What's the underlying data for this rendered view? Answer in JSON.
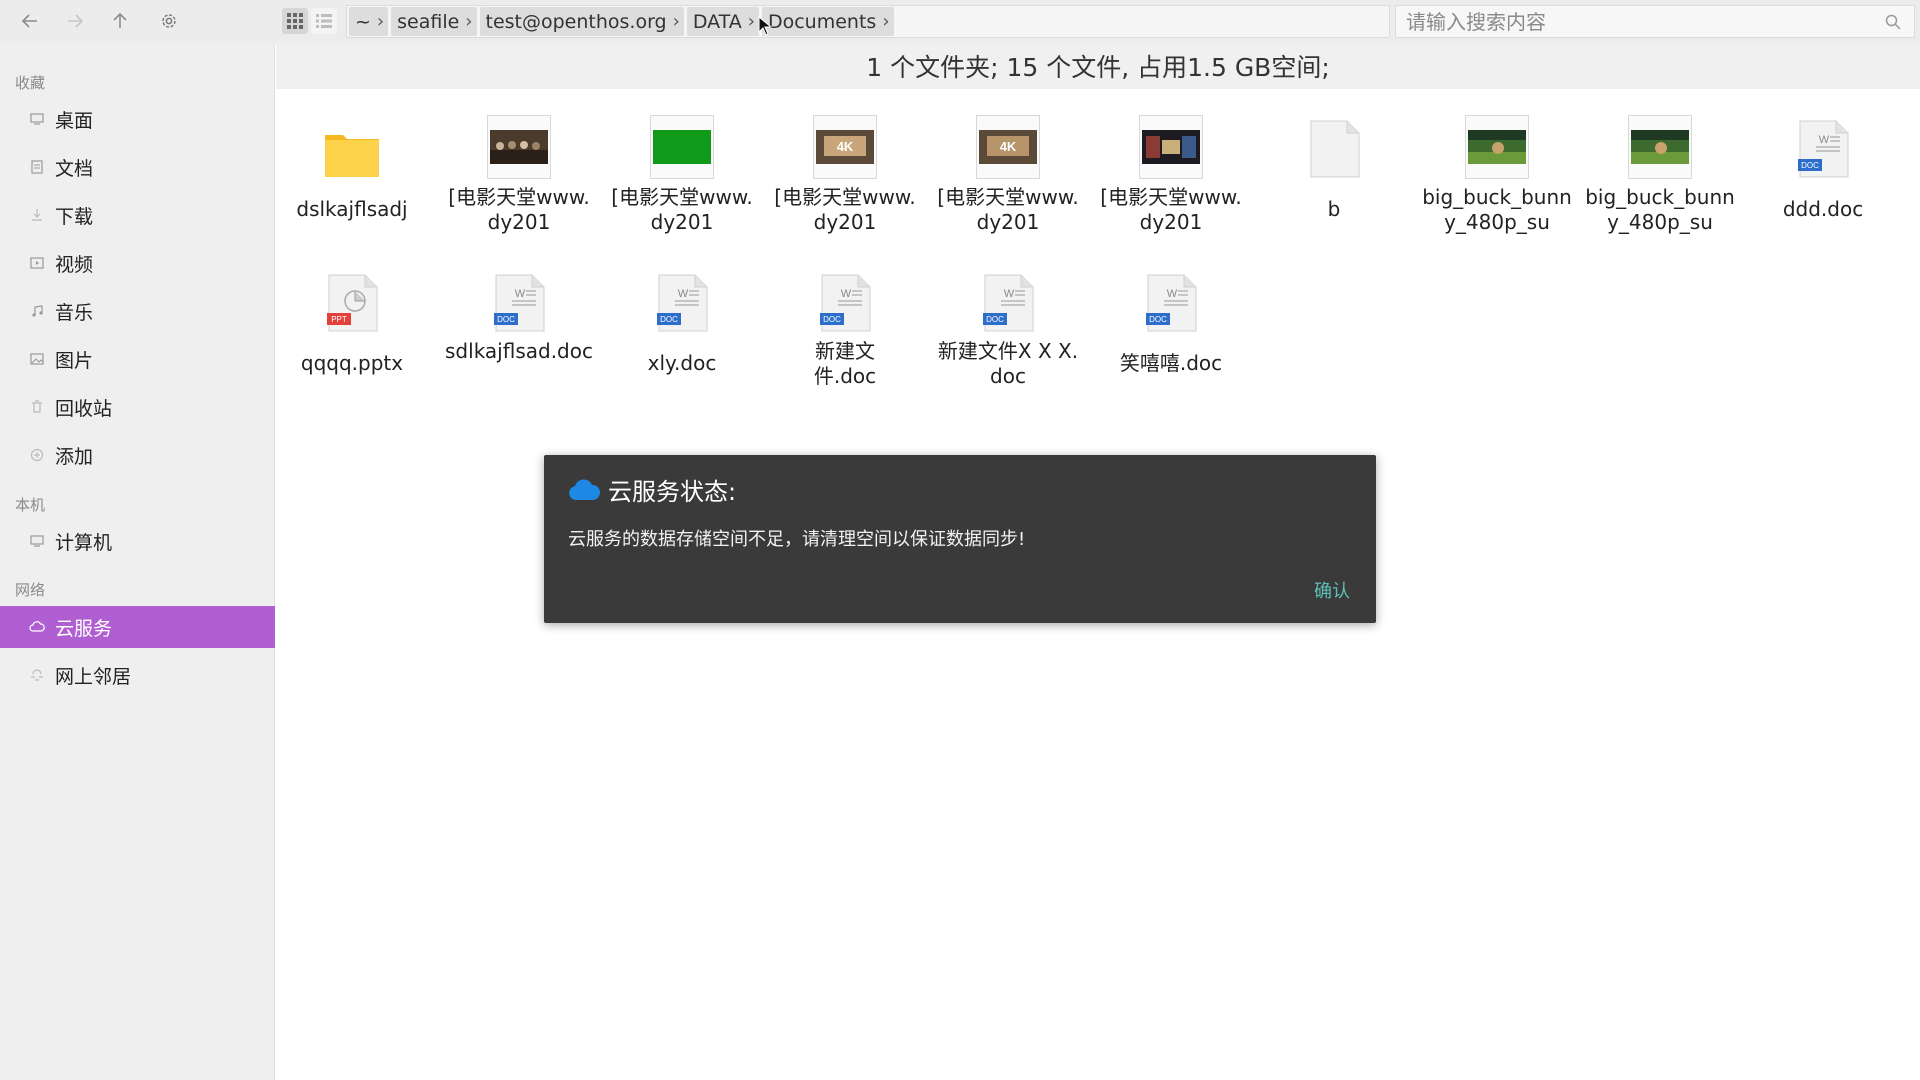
{
  "toolbar": {
    "icons": [
      "back-arrow-icon",
      "forward-arrow-icon",
      "up-arrow-icon",
      "gear-icon",
      "grid-view-icon",
      "list-view-icon"
    ]
  },
  "breadcrumb": [
    "~",
    "seafile",
    "test@openthos.org",
    "DATA",
    "Documents"
  ],
  "search": {
    "placeholder": "请输入搜索内容",
    "value": ""
  },
  "sidebar": {
    "sections": {
      "favorites": "收藏",
      "local": "本机",
      "network": "网络"
    },
    "favorites": [
      {
        "label": "桌面",
        "icon": "desktop-icon"
      },
      {
        "label": "文档",
        "icon": "document-icon"
      },
      {
        "label": "下载",
        "icon": "download-icon"
      },
      {
        "label": "视频",
        "icon": "video-icon"
      },
      {
        "label": "音乐",
        "icon": "music-icon"
      },
      {
        "label": "图片",
        "icon": "picture-icon"
      },
      {
        "label": "回收站",
        "icon": "trash-icon"
      },
      {
        "label": "添加",
        "icon": "add-icon"
      }
    ],
    "local": [
      {
        "label": "计算机",
        "icon": "computer-icon"
      }
    ],
    "network": [
      {
        "label": "云服务",
        "icon": "cloud-icon",
        "selected": true
      },
      {
        "label": "网上邻居",
        "icon": "network-neighborhood-icon"
      }
    ],
    "selected_color": "#b05fd2"
  },
  "status": "1 个文件夹;  15 个文件, 占用1.5 GB空间;",
  "files_row1": [
    {
      "name": "dslkajflsadj",
      "type": "folder"
    },
    {
      "name": "[电影天堂www.dy201",
      "type": "video"
    },
    {
      "name": "[电影天堂www.dy201",
      "type": "video"
    },
    {
      "name": "[电影天堂www.dy201",
      "type": "video"
    },
    {
      "name": "[电影天堂www.dy201",
      "type": "video"
    },
    {
      "name": "[电影天堂www.dy201",
      "type": "video"
    },
    {
      "name": "b",
      "type": "file"
    },
    {
      "name": "big_buck_bunny_480p_su",
      "type": "video"
    },
    {
      "name": "big_buck_bunny_480p_su",
      "type": "video"
    },
    {
      "name": "ddd.doc",
      "type": "doc"
    }
  ],
  "files_row2": [
    {
      "name": "qqqq.pptx",
      "type": "ppt"
    },
    {
      "name": "sdlkajflsad.doc",
      "type": "doc"
    },
    {
      "name": "xly.doc",
      "type": "doc"
    },
    {
      "name": "新建文件.doc",
      "type": "doc"
    },
    {
      "name": "新建文件X X X.doc",
      "type": "doc"
    },
    {
      "name": "笑嘻嘻.doc",
      "type": "doc"
    }
  ],
  "dialog": {
    "title": "云服务状态:",
    "message": "云服务的数据存储空间不足，请清理空间以保证数据同步!",
    "ok_label": "确认"
  }
}
